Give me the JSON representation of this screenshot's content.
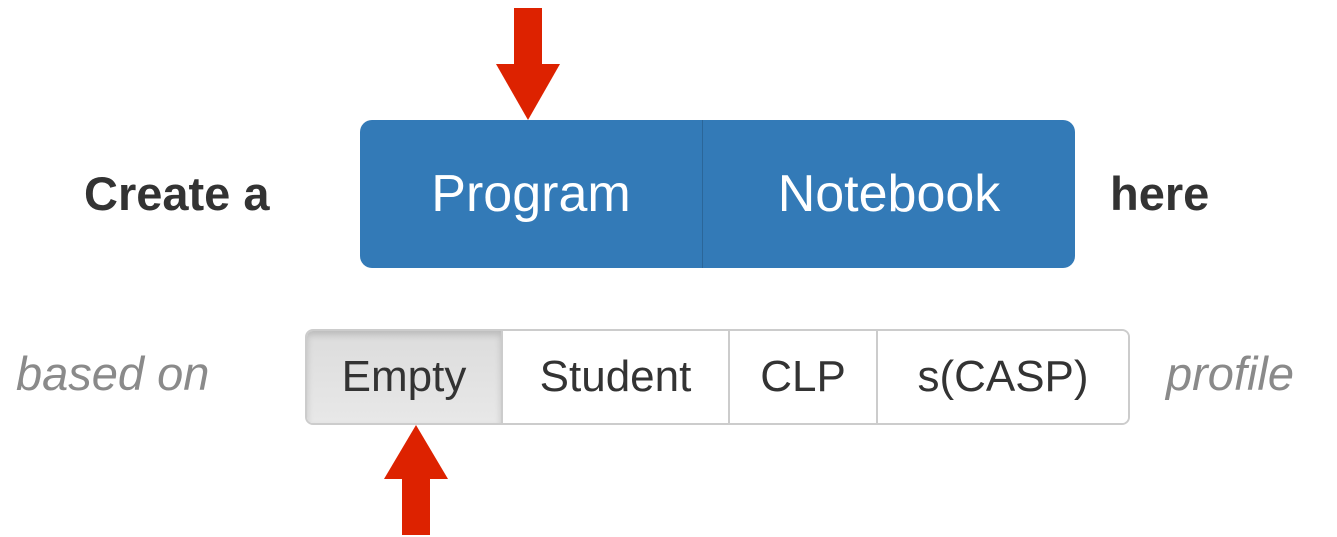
{
  "create_row": {
    "prefix": "Create a",
    "buttons": [
      {
        "label": "Program"
      },
      {
        "label": "Notebook"
      }
    ],
    "suffix": "here"
  },
  "profile_row": {
    "prefix": "based on",
    "options": [
      {
        "label": "Empty",
        "selected": true
      },
      {
        "label": "Student",
        "selected": false
      },
      {
        "label": "CLP",
        "selected": false
      },
      {
        "label": "s(CASP)",
        "selected": false
      }
    ],
    "suffix": "profile"
  },
  "colors": {
    "primary_button": "#337ab7",
    "annotation_arrow": "#dd2200"
  },
  "annotations": [
    {
      "icon": "arrow-down-icon",
      "points_to": "Program"
    },
    {
      "icon": "arrow-up-icon",
      "points_to": "Empty"
    }
  ]
}
